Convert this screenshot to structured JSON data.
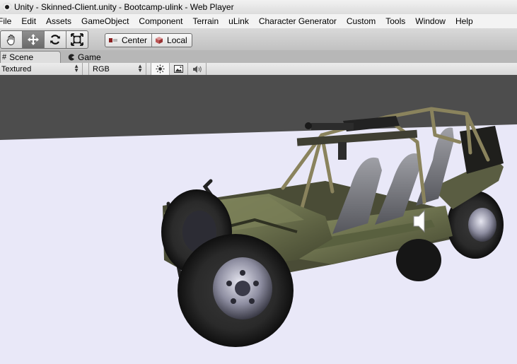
{
  "window": {
    "title": "Unity - Skinned-Client.unity - Bootcamp-ulink - Web Player",
    "app_icon": "unity-logo-icon"
  },
  "menubar": {
    "items": [
      "File",
      "Edit",
      "Assets",
      "GameObject",
      "Component",
      "Terrain",
      "uLink",
      "Character Generator",
      "Custom",
      "Tools",
      "Window",
      "Help"
    ]
  },
  "toolbar": {
    "tools": [
      {
        "name": "hand-tool",
        "icon": "hand-icon",
        "active": false
      },
      {
        "name": "move-tool",
        "icon": "move-arrows-icon",
        "active": true
      },
      {
        "name": "rotate-tool",
        "icon": "rotate-icon",
        "active": false
      },
      {
        "name": "scale-tool",
        "icon": "scale-icon",
        "active": false
      }
    ],
    "pivot_label": "Center",
    "space_label": "Local"
  },
  "tabs": {
    "scene_label": "Scene",
    "game_label": "Game",
    "active": "Scene"
  },
  "scene_view": {
    "draw_mode": "Textured",
    "render_mode": "RGB",
    "lighting_icon": "sun-icon",
    "image_icon": "picture-icon",
    "audio_icon": "speaker-icon"
  },
  "colors": {
    "horizon_gray": "#4d4d4d",
    "ground": "#e9e8f8"
  }
}
